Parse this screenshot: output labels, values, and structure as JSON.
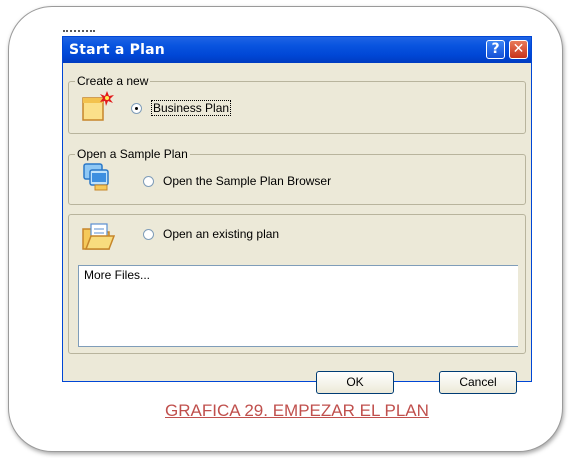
{
  "dialog": {
    "title": "Start a Plan",
    "help_label": "?",
    "close_label": "✕"
  },
  "groups": {
    "create_new": {
      "legend": "Create a new",
      "option_label": "Business Plan",
      "selected": true,
      "icon": "new-plan-icon"
    },
    "open_sample": {
      "legend": "Open a Sample Plan",
      "option_label": "Open the Sample Plan Browser",
      "selected": false,
      "icon": "sample-browser-icon"
    },
    "open_existing": {
      "option_label": "Open an existing plan",
      "selected": false,
      "icon": "open-folder-icon",
      "files": [
        "More Files..."
      ]
    }
  },
  "buttons": {
    "ok": "OK",
    "cancel": "Cancel"
  },
  "caption": "GRAFICA 29. EMPEZAR EL PLAN",
  "colors": {
    "title_bar": "#0a55e0",
    "caption": "#c0504d",
    "dialog_bg": "#ece9d8"
  }
}
